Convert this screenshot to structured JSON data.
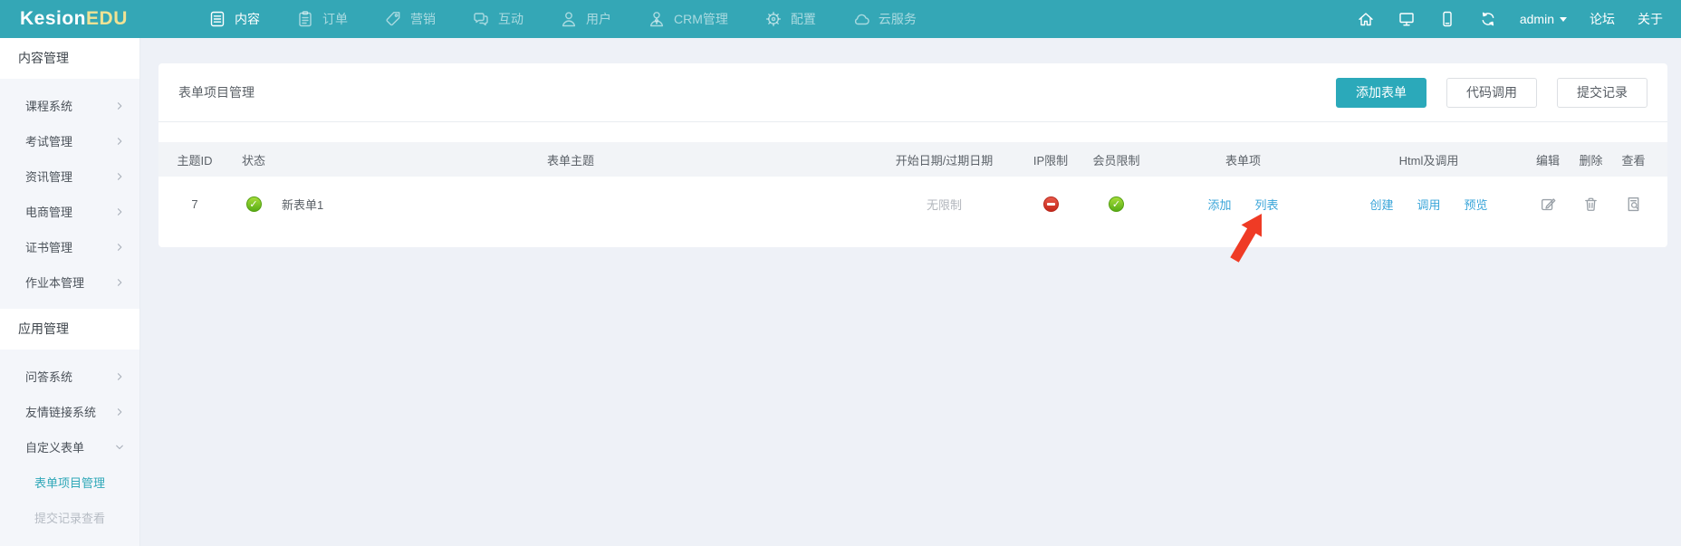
{
  "brand": {
    "name": "Kesion",
    "accent": "EDU"
  },
  "navbar": {
    "items": [
      {
        "key": "content",
        "label": "内容",
        "icon": "document-icon",
        "active": true
      },
      {
        "key": "orders",
        "label": "订单",
        "icon": "clipboard-icon",
        "active": false
      },
      {
        "key": "marketing",
        "label": "营销",
        "icon": "tag-icon",
        "active": false
      },
      {
        "key": "interaction",
        "label": "互动",
        "icon": "chat-icon",
        "active": false
      },
      {
        "key": "users",
        "label": "用户",
        "icon": "user-icon",
        "active": false
      },
      {
        "key": "crm",
        "label": "CRM管理",
        "icon": "crm-user-icon",
        "active": false
      },
      {
        "key": "settings",
        "label": "配置",
        "icon": "gear-icon",
        "active": false
      },
      {
        "key": "cloud",
        "label": "云服务",
        "icon": "cloud-icon",
        "active": false
      }
    ],
    "right_icons": [
      "home-icon",
      "monitor-icon",
      "mobile-icon",
      "refresh-icon"
    ],
    "username": "admin",
    "links": [
      {
        "key": "forum",
        "label": "论坛"
      },
      {
        "key": "about",
        "label": "关于"
      }
    ]
  },
  "sidebar": {
    "sections": [
      {
        "title": "内容管理",
        "items": [
          {
            "key": "course-system",
            "label": "课程系统",
            "chevron": "right"
          },
          {
            "key": "exam-management",
            "label": "考试管理",
            "chevron": "right"
          },
          {
            "key": "news-management",
            "label": "资讯管理",
            "chevron": "right"
          },
          {
            "key": "ecommerce-management",
            "label": "电商管理",
            "chevron": "right"
          },
          {
            "key": "certificate-management",
            "label": "证书管理",
            "chevron": "right"
          },
          {
            "key": "workbook-management",
            "label": "作业本管理",
            "chevron": "right"
          }
        ]
      },
      {
        "title": "应用管理",
        "items": [
          {
            "key": "qa-system",
            "label": "问答系统",
            "chevron": "right"
          },
          {
            "key": "friend-link-system",
            "label": "友情链接系统",
            "chevron": "right"
          },
          {
            "key": "custom-forms",
            "label": "自定义表单",
            "chevron": "down",
            "expanded": true,
            "children": [
              {
                "key": "form-project-management",
                "label": "表单项目管理",
                "active": true
              },
              {
                "key": "submission-records",
                "label": "提交记录查看",
                "active": false
              }
            ]
          }
        ]
      }
    ]
  },
  "main": {
    "title": "表单项目管理",
    "toolbar": {
      "add_form": "添加表单",
      "code_call": "代码调用",
      "submit_records": "提交记录"
    },
    "table": {
      "headers": [
        "主题ID",
        "状态",
        "表单主题",
        "开始日期/过期日期",
        "IP限制",
        "会员限制",
        "表单项",
        "Html及调用",
        "编辑",
        "删除",
        "查看"
      ],
      "rows": [
        {
          "id": "7",
          "status": "enabled",
          "subject": "新表单1",
          "date_range": "无限制",
          "ip_limit": "blocked",
          "member_limit": "allowed",
          "form_item_links": [
            {
              "key": "add",
              "label": "添加"
            },
            {
              "key": "list",
              "label": "列表"
            }
          ],
          "html_links": [
            {
              "key": "create",
              "label": "创建"
            },
            {
              "key": "invoke",
              "label": "调用"
            },
            {
              "key": "preview",
              "label": "预览"
            }
          ],
          "action_icons": [
            "edit-icon",
            "delete-icon",
            "view-icon"
          ]
        }
      ]
    },
    "annotation": {
      "type": "arrow",
      "color": "#ef3b25",
      "points_at": "列表"
    }
  },
  "colors": {
    "navbar": "#34a7b6",
    "logo_accent": "#f0e294",
    "primary_button": "#2ba9ba",
    "link": "#3aa5d9",
    "sidebar_active": "#2fa8b8",
    "status_green": "#6cc318",
    "status_red": "#dd3528",
    "arrow": "#ef3b25"
  }
}
